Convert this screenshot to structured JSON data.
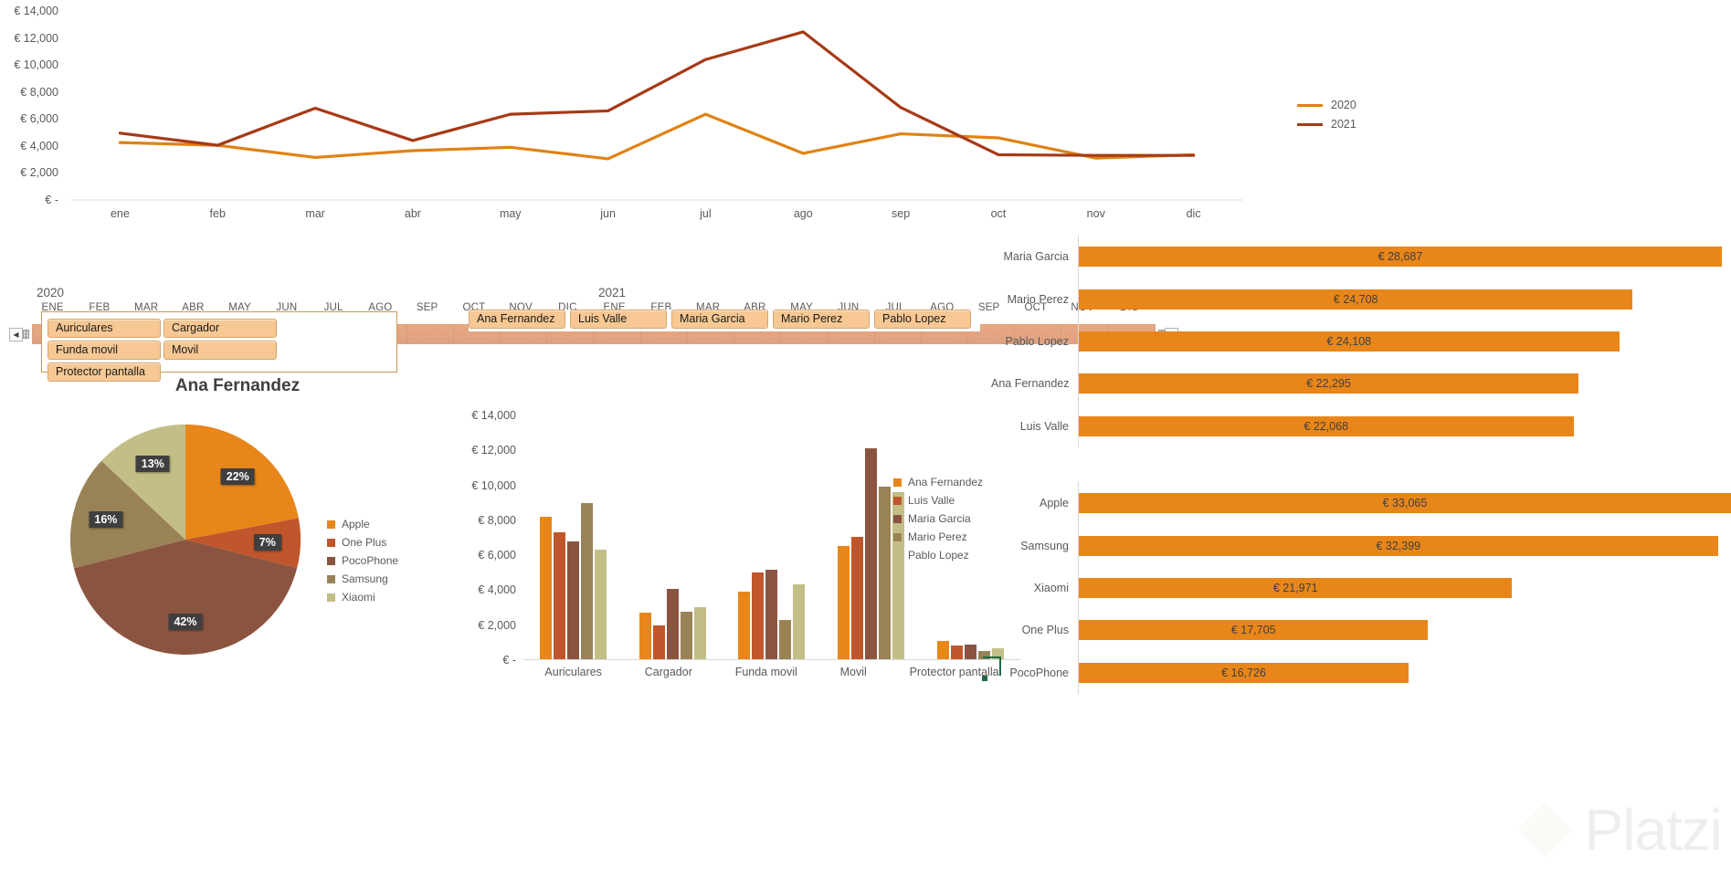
{
  "colors": {
    "series_2020": "#E08214",
    "series_2021": "#A63A17",
    "brand_apple": "#E8861A",
    "brand_oneplus": "#C0562B",
    "brand_pocophone": "#8A5440",
    "brand_samsung": "#9A8257",
    "brand_xiaomi": "#C3BE86",
    "slicer_fill": "#F7C893",
    "slicer_border": "#C89A52",
    "timeline_fill": "#E3A585",
    "hbar_fill": "#E8861A",
    "axis_text": "#595959"
  },
  "line_chart": {
    "chart_data": {
      "type": "line",
      "title": "",
      "xlabel": "",
      "ylabel": "",
      "ylim": [
        0,
        14000
      ],
      "yticks": [
        "€ 14,000",
        "€ 12,000",
        "€ 10,000",
        "€ 8,000",
        "€ 6,000",
        "€ 4,000",
        "€ 2,000",
        "€ -"
      ],
      "ytick_values": [
        14000,
        12000,
        10000,
        8000,
        6000,
        4000,
        2000,
        0
      ],
      "categories": [
        "ene",
        "feb",
        "mar",
        "abr",
        "may",
        "jun",
        "jul",
        "ago",
        "sep",
        "oct",
        "nov",
        "dic"
      ],
      "grid": false,
      "legend_position": "right",
      "series": [
        {
          "name": "2020",
          "color": "#E08214",
          "values": [
            4250,
            4050,
            3150,
            3650,
            3900,
            3050,
            6350,
            3450,
            4900,
            4600,
            3100,
            3350
          ]
        },
        {
          "name": "2021",
          "color": "#A63A17",
          "values": [
            4950,
            4050,
            6800,
            4400,
            6350,
            6600,
            10400,
            12450,
            6850,
            3350,
            3300,
            3300
          ]
        }
      ]
    },
    "legend": [
      {
        "label": "2020",
        "color": "#E08214"
      },
      {
        "label": "2021",
        "color": "#A63A17"
      }
    ]
  },
  "timeline_slicer": {
    "name": "timeline-slicer",
    "years": [
      "2020",
      "2021"
    ],
    "months": [
      "ENE",
      "FEB",
      "MAR",
      "ABR",
      "MAY",
      "JUN",
      "JUL",
      "AGO",
      "SEP",
      "OCT",
      "NOV",
      "DIC"
    ],
    "prev_label": "◀",
    "next_label": "▶"
  },
  "product_slicer": {
    "items": [
      {
        "label": "Auriculares"
      },
      {
        "label": "Cargador"
      },
      {
        "label": "Funda movil"
      },
      {
        "label": "Movil"
      },
      {
        "label": "Protector pantalla"
      }
    ]
  },
  "person_slicer": {
    "items": [
      {
        "label": "Ana Fernandez"
      },
      {
        "label": "Luis Valle"
      },
      {
        "label": "Maria Garcia"
      },
      {
        "label": "Mario Perez"
      },
      {
        "label": "Pablo Lopez"
      }
    ]
  },
  "pie_chart": {
    "title": "Ana Fernandez",
    "chart_data": {
      "type": "pie",
      "title": "Ana Fernandez",
      "categories": [
        "Apple",
        "One Plus",
        "PocoPhone",
        "Samsung",
        "Xiaomi"
      ],
      "values": [
        22,
        7,
        42,
        16,
        13
      ],
      "labels": [
        "22%",
        "7%",
        "42%",
        "16%",
        "13%"
      ],
      "colors": [
        "#E8861A",
        "#C0562B",
        "#8A5440",
        "#9A8257",
        "#C3BE86"
      ],
      "legend_position": "right"
    },
    "legend": [
      {
        "label": "Apple",
        "color": "#E8861A"
      },
      {
        "label": "One Plus",
        "color": "#C0562B"
      },
      {
        "label": "PocoPhone",
        "color": "#8A5440"
      },
      {
        "label": "Samsung",
        "color": "#9A8257"
      },
      {
        "label": "Xiaomi",
        "color": "#C3BE86"
      }
    ]
  },
  "column_chart": {
    "chart_data": {
      "type": "bar",
      "title": "",
      "xlabel": "",
      "ylabel": "",
      "ylim": [
        0,
        14000
      ],
      "yticks": [
        "€ 14,000",
        "€ 12,000",
        "€ 10,000",
        "€ 8,000",
        "€ 6,000",
        "€ 4,000",
        "€ 2,000",
        "€ -"
      ],
      "ytick_values": [
        14000,
        12000,
        10000,
        8000,
        6000,
        4000,
        2000,
        0
      ],
      "categories": [
        "Auriculares",
        "Cargador",
        "Funda movil",
        "Movil",
        "Protector pantalla"
      ],
      "legend_position": "right",
      "series": [
        {
          "name": "Ana Fernandez",
          "color": "#E8861A",
          "values": [
            8150,
            2650,
            3870,
            6480,
            1060
          ]
        },
        {
          "name": "Luis Valle",
          "color": "#C0562B",
          "values": [
            7250,
            1950,
            4980,
            7020,
            760
          ]
        },
        {
          "name": "Maria Garcia",
          "color": "#8A5440",
          "values": [
            6720,
            4000,
            5100,
            12050,
            830
          ]
        },
        {
          "name": "Mario Perez",
          "color": "#9A8257",
          "values": [
            8950,
            2720,
            2270,
            9900,
            480
          ]
        },
        {
          "name": "Pablo Lopez",
          "color": "#C3BE86",
          "values": [
            6250,
            2960,
            4260,
            9550,
            640
          ]
        }
      ]
    },
    "legend": [
      {
        "label": "Ana Fernandez",
        "color": "#E8861A"
      },
      {
        "label": "Luis Valle",
        "color": "#C0562B"
      },
      {
        "label": "Maria Garcia",
        "color": "#8A5440"
      },
      {
        "label": "Mario Perez",
        "color": "#9A8257"
      },
      {
        "label": "Pablo Lopez",
        "color": "#C3BE86"
      }
    ]
  },
  "hbar_people": {
    "chart_data": {
      "type": "bar",
      "orientation": "horizontal",
      "title": "",
      "categories": [
        "Maria Garcia",
        "Mario Perez",
        "Pablo Lopez",
        "Ana Fernandez",
        "Luis Valle"
      ],
      "values": [
        28687,
        24708,
        24108,
        22295,
        22068
      ],
      "labels": [
        "€ 28,687",
        "€ 24,708",
        "€ 24,108",
        "€ 22,295",
        "€ 22,068"
      ],
      "max": 28687,
      "color": "#E8861A"
    }
  },
  "hbar_brands": {
    "chart_data": {
      "type": "bar",
      "orientation": "horizontal",
      "title": "",
      "categories": [
        "Apple",
        "Samsung",
        "Xiaomi",
        "One Plus",
        "PocoPhone"
      ],
      "values": [
        33065,
        32399,
        21971,
        17705,
        16726
      ],
      "labels": [
        "€ 33,065",
        "€ 32,399",
        "€ 21,971",
        "€ 17,705",
        "€ 16,726"
      ],
      "max": 33065,
      "color": "#E8861A"
    }
  },
  "watermark": {
    "text": "Platzi"
  }
}
